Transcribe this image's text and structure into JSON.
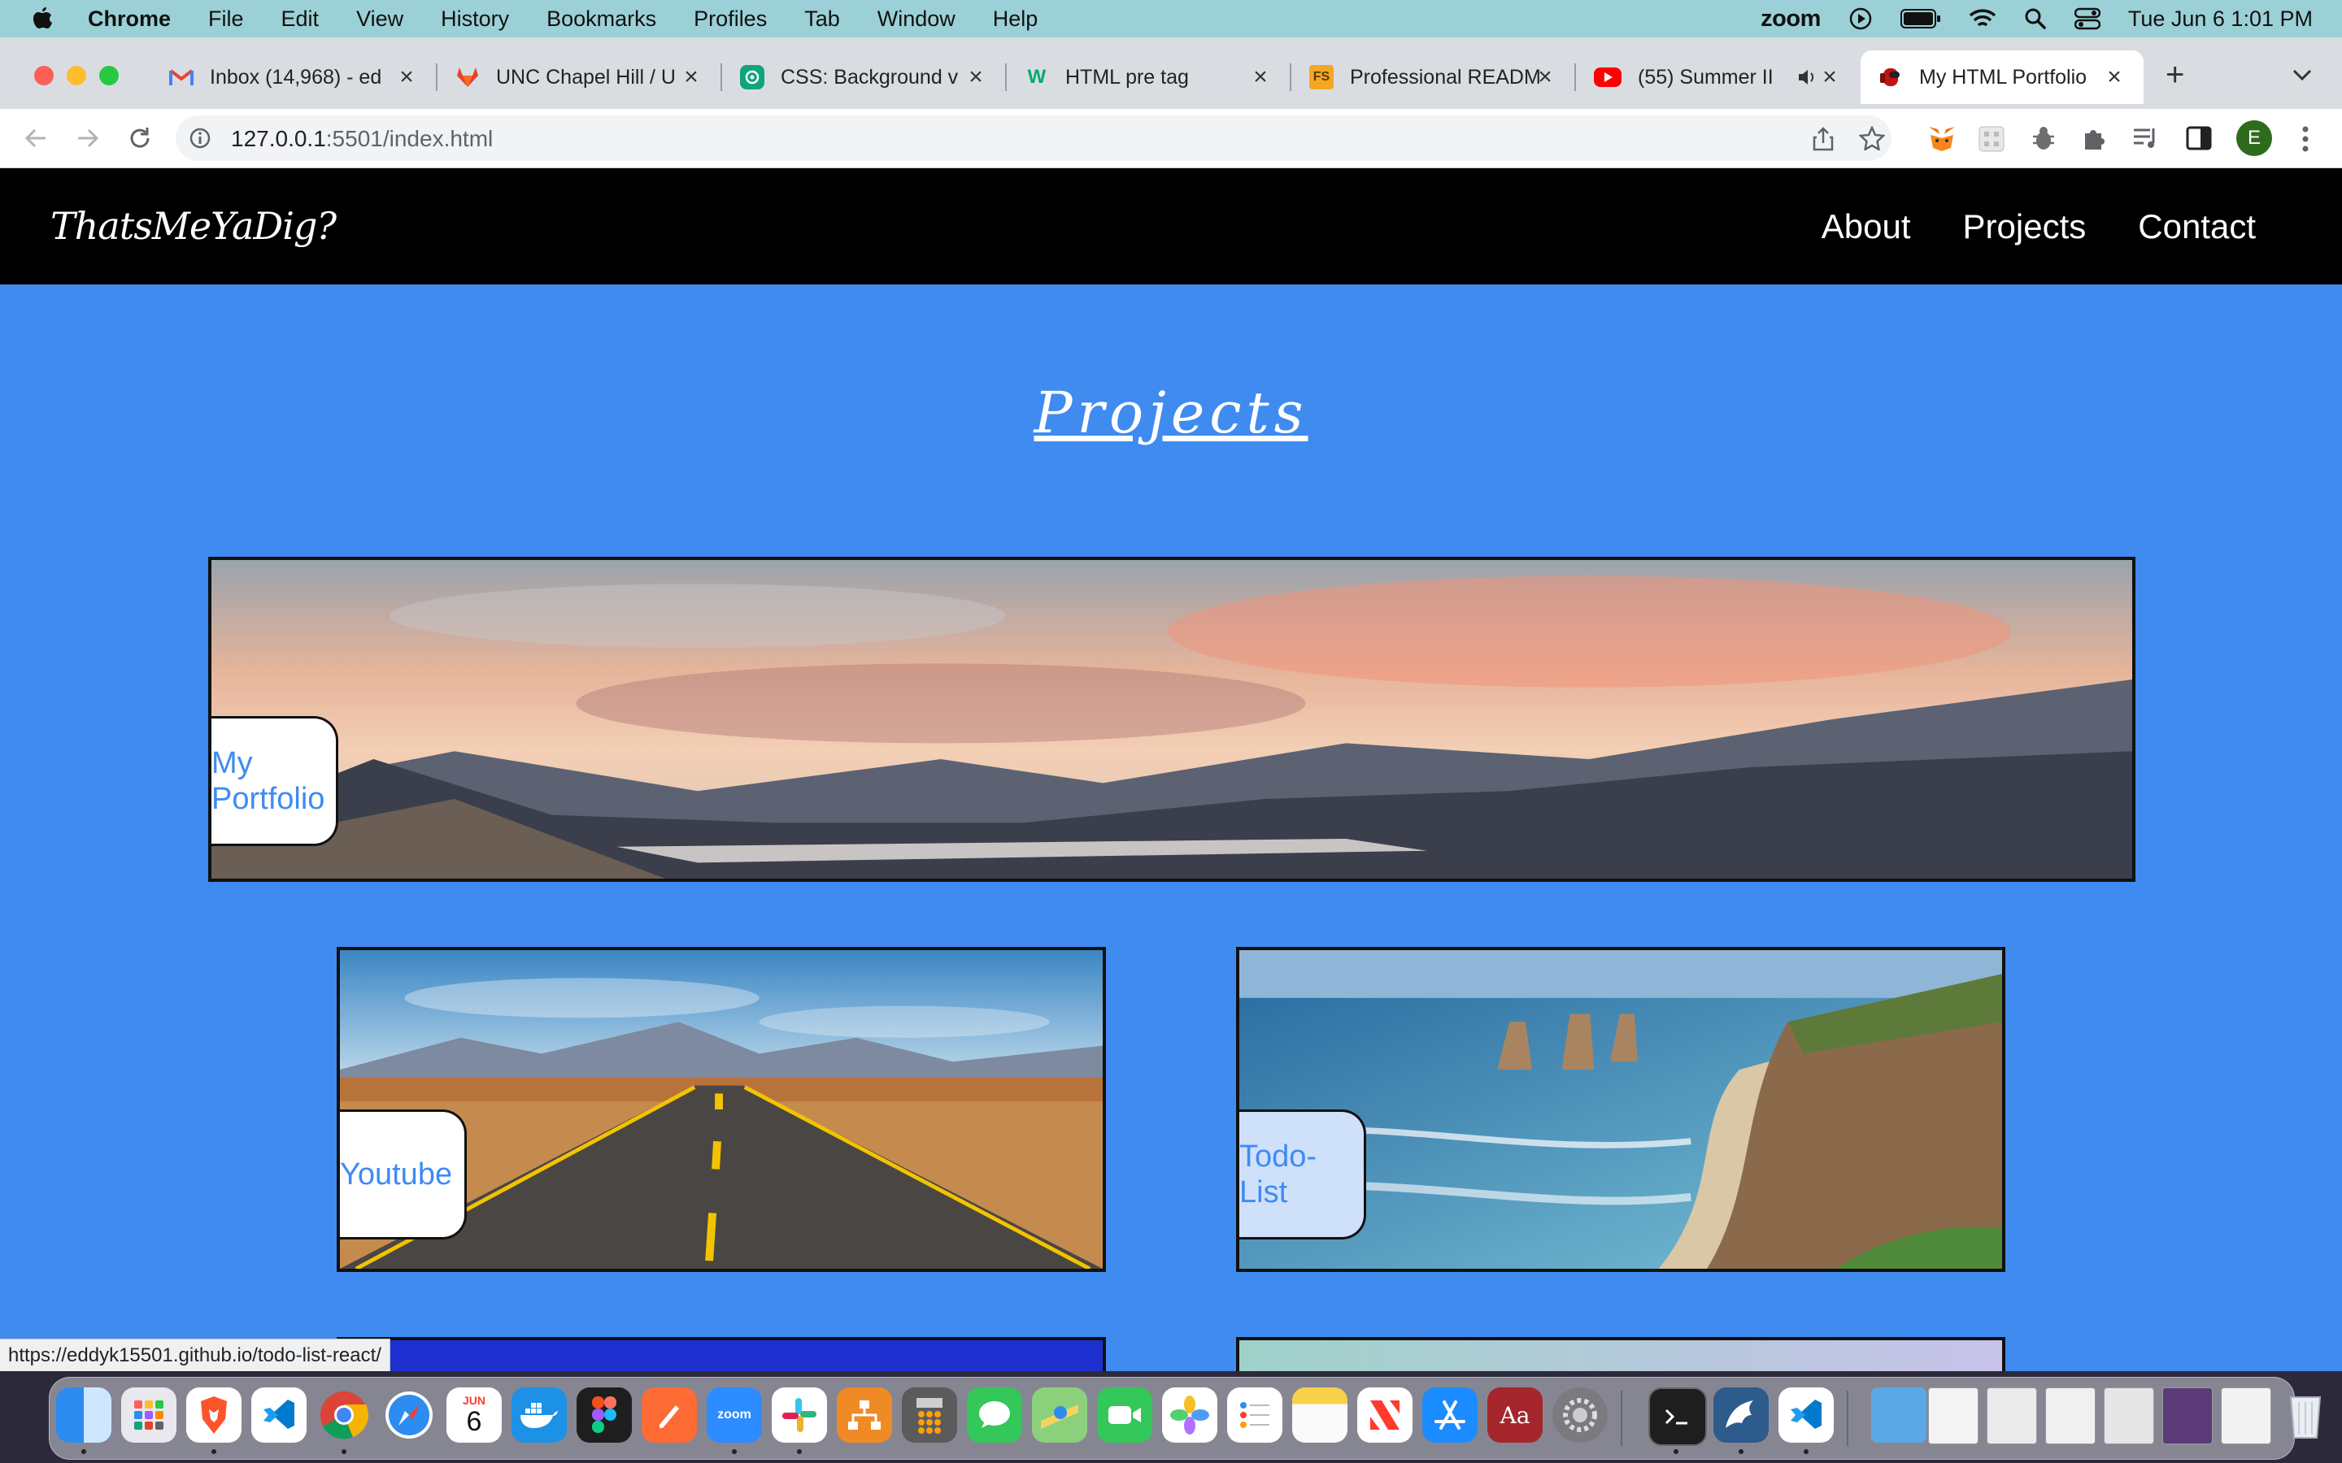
{
  "menubar": {
    "items": [
      "Chrome",
      "File",
      "Edit",
      "View",
      "History",
      "Bookmarks",
      "Profiles",
      "Tab",
      "Window",
      "Help"
    ],
    "zoom_label": "zoom",
    "datetime": "Tue Jun 6  1:01 PM"
  },
  "tabs": [
    {
      "title": "Inbox (14,968) - ed",
      "icon": "gmail-icon",
      "color": "#ea4335"
    },
    {
      "title": "UNC Chapel Hill / U",
      "icon": "gitlab-icon",
      "color": "#e24329"
    },
    {
      "title": "CSS: Background v",
      "icon": "chatgpt-icon",
      "color": "#10a37f"
    },
    {
      "title": "HTML pre tag",
      "icon": "w3schools-icon",
      "color": "#04aa6d"
    },
    {
      "title": "Professional READM",
      "icon": "fs-icon",
      "color": "#f5a623"
    },
    {
      "title": "(55) Summer II",
      "icon": "youtube-icon",
      "color": "#ff0000"
    },
    {
      "title": "My HTML Portfolio",
      "icon": "among-us-icon",
      "color": "#c51111"
    }
  ],
  "address": {
    "host": "127.0.0.1",
    "path": ":5501/index.html"
  },
  "profile_initial": "E",
  "site": {
    "logo": "ThatsMeYaDig?",
    "nav": [
      "About",
      "Projects",
      "Contact"
    ],
    "section_title": "Projects",
    "projects": [
      {
        "label_line1": "My",
        "label_line2": "Portfolio"
      },
      {
        "label": "Youtube"
      },
      {
        "label": "Todo-List"
      }
    ]
  },
  "status_url": "https://eddyk15501.github.io/todo-list-react/",
  "dock": {
    "calendar_month": "JUN",
    "calendar_day": "6",
    "zoom_label": "zoom",
    "dictionary_label": "Aa"
  },
  "colors": {
    "page_bg": "#3f8bf0",
    "nav_bg": "#000000",
    "label_text": "#3f8bf0"
  }
}
